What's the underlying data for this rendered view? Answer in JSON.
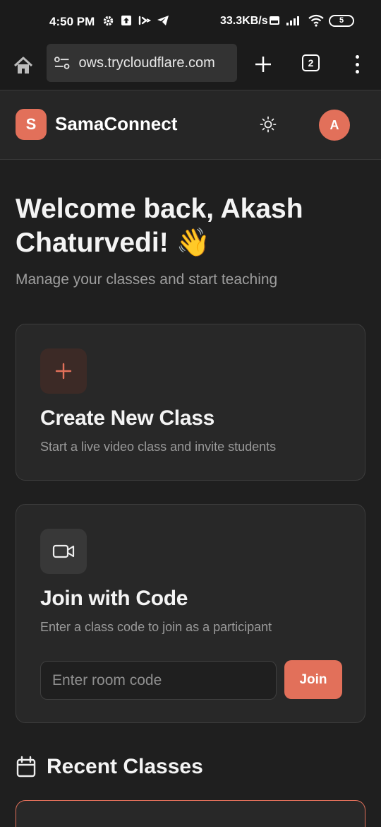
{
  "status_bar": {
    "time": "4:50 PM",
    "net_speed": "33.3KB/s",
    "battery": "5"
  },
  "browser": {
    "url": "ows.trycloudflare.com",
    "tab_count": "2"
  },
  "header": {
    "logo_letter": "S",
    "brand": "SamaConnect",
    "avatar_letter": "A"
  },
  "welcome": {
    "title": "Welcome back, Akash Chaturvedi! 👋",
    "subtitle": "Manage your classes and start teaching"
  },
  "create_card": {
    "title": "Create New Class",
    "description": "Start a live video class and invite students"
  },
  "join_card": {
    "title": "Join with Code",
    "description": "Enter a class code to join as a participant",
    "input_placeholder": "Enter room code",
    "input_value": "",
    "button_label": "Join"
  },
  "recent": {
    "title": "Recent Classes"
  },
  "colors": {
    "accent": "#e2705a",
    "background": "#1f1f1f",
    "card": "#282828"
  }
}
